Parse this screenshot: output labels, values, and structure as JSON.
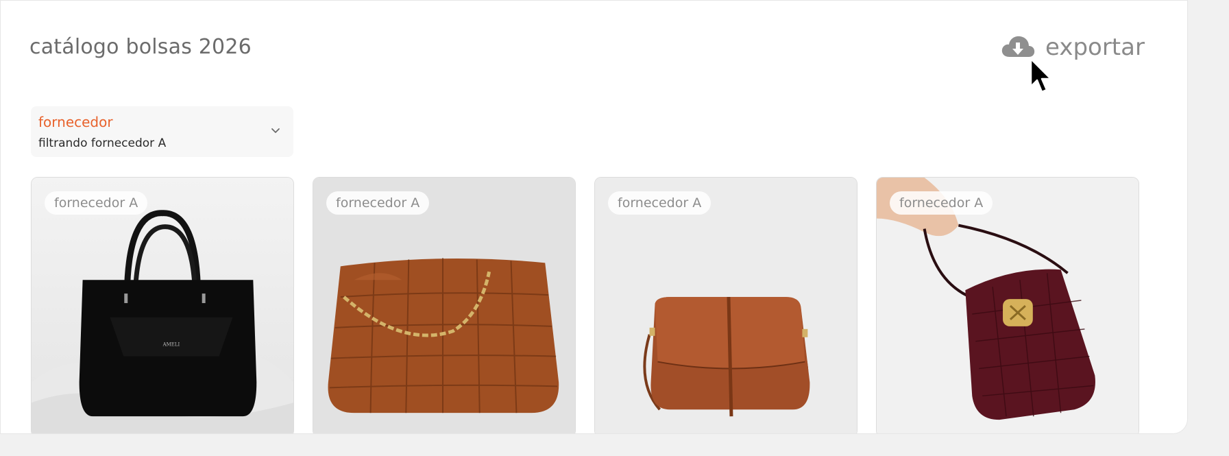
{
  "header": {
    "title": "catálogo bolsas 2026",
    "export_label": "exportar",
    "export_icon": "cloud-download-icon"
  },
  "filter": {
    "label": "fornecedor",
    "value": "filtrando fornecedor A",
    "icon": "chevron-down-icon"
  },
  "products": [
    {
      "tag": "fornecedor A",
      "image": "black leather tote bag"
    },
    {
      "tag": "fornecedor A",
      "image": "brown woven leather bag with gold chain"
    },
    {
      "tag": "fornecedor A",
      "image": "brown leather crossbody bag"
    },
    {
      "tag": "fornecedor A",
      "image": "burgundy croc-embossed bag held by hand"
    }
  ],
  "colors": {
    "accent": "#e8622c",
    "title": "#6b6b6b",
    "background": "#f1f1f1"
  }
}
